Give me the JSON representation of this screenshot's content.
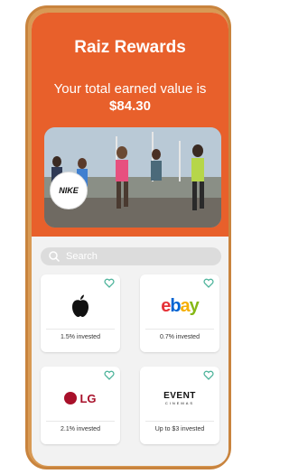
{
  "header": {
    "title": "Raiz Rewards",
    "subtitle": "Your total earned value is",
    "earned_value": "$84.30",
    "banner_brand": "NIKE"
  },
  "search": {
    "placeholder": "Search"
  },
  "rewards": [
    {
      "brand": "Apple",
      "caption": "1.5% invested"
    },
    {
      "brand": "ebay",
      "caption": "0.7% invested"
    },
    {
      "brand": "LG",
      "caption": "2.1% invested"
    },
    {
      "brand": "EVENT",
      "brand_sub": "CINEMAS",
      "caption": "Up to $3 invested"
    }
  ],
  "colors": {
    "accent": "#e8602b",
    "heart": "#4cb39a",
    "frame": "#d89a55"
  }
}
